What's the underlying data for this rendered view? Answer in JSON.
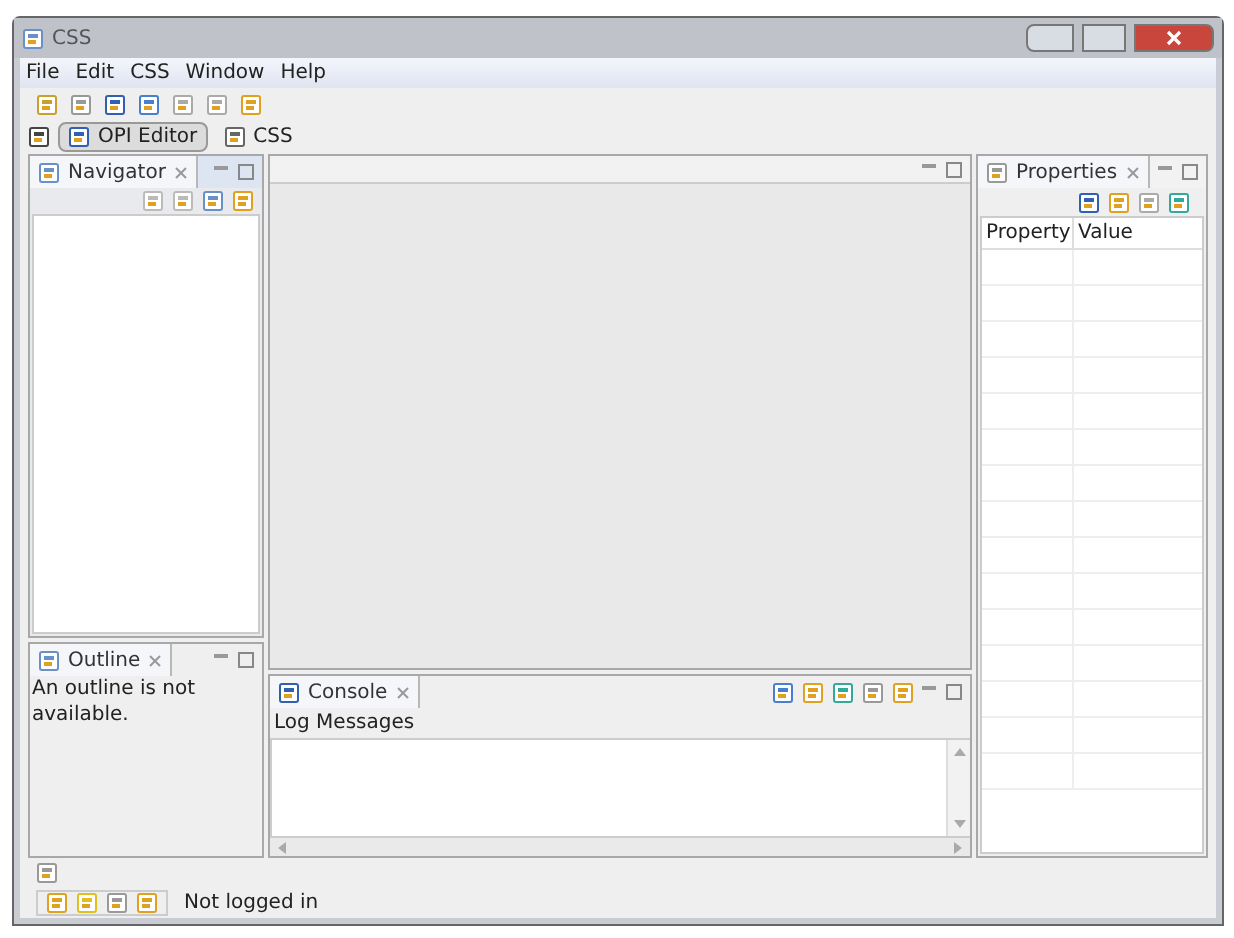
{
  "window": {
    "title": "CSS"
  },
  "menu": [
    "File",
    "Edit",
    "CSS",
    "Window",
    "Help"
  ],
  "perspectives": [
    {
      "label": "OPI Editor",
      "selected": true
    },
    {
      "label": "CSS",
      "selected": false
    }
  ],
  "navigator": {
    "title": "Navigator"
  },
  "outline": {
    "title": "Outline",
    "message": "An outline is not available."
  },
  "console": {
    "title": "Console",
    "subtitle": "Log Messages"
  },
  "properties": {
    "title": "Properties",
    "columns": [
      "Property",
      "Value"
    ]
  },
  "status_bar": {
    "login": "Not logged in"
  }
}
